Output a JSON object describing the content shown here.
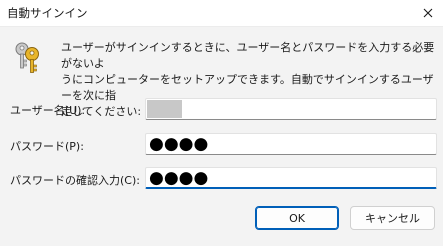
{
  "window": {
    "title": "自動サインイン",
    "close_icon": "close-icon"
  },
  "message": {
    "icon": "keys-icon",
    "text": "ユーザーがサインインするときに、ユーザー名とパスワードを入力する必要がないよ\nうにコンピューターをセットアップできます。自動でサインインするユーザーを次に指\n定してください:"
  },
  "form": {
    "username_label": "ユーザー名(U):",
    "username_value": "",
    "password_label": "パスワード(P):",
    "password_mask": "●●●●",
    "confirm_label": "パスワードの確認入力(C):",
    "confirm_mask": "●●●●"
  },
  "buttons": {
    "ok": "OK",
    "cancel": "キャンセル"
  },
  "colors": {
    "accent": "#005fb8",
    "background": "#f3f3f3",
    "key_gold": "#d9a520"
  }
}
